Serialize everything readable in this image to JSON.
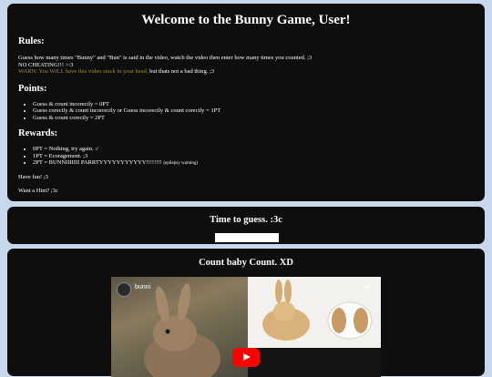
{
  "rules_panel": {
    "title": "Welcome to the Bunny Game, User!",
    "rules_heading": "Rules:",
    "rules_line1": "Guess how many times \"Bunny\" and \"Bun\" is said in the video, watch the video then enter how many times you counted. ;3",
    "rules_line2": "NO CHEATING!!! >:3",
    "warn_text": "WARN: You WILL have this video stuck in your head,",
    "warn_tail": " but thats not a bad thing. ;3",
    "points_heading": "Points:",
    "points": [
      "Guess & count incorectly = 0PT",
      "Guess corectly & count incorrectly or Guess incorectly & count corectly = 1PT",
      "Guess & count corectly = 2PT"
    ],
    "rewards_heading": "Rewards:",
    "reward0": "0PT = Nothing, try again. :/",
    "reward1": "1PT = Ecoragement. ;3",
    "reward2_main": "2PT = BUNNIIIIIII PARRTYYYYYYYYYYY!!!!!!!! ",
    "reward2_note": "(epilepsy warning)",
    "have_fun": "Have fun! ;3",
    "want_hint": "Want a Hint? ;3c"
  },
  "timer_panel": {
    "title": "Time to guess. :3c",
    "guess_value": ""
  },
  "video_panel": {
    "title": "Count baby Count. XD",
    "channel_name": "bunni",
    "share_label": "➦"
  },
  "colors": {
    "page_bg": "#c8d8ec",
    "panel_bg": "#0e0e0e",
    "warn": "#9a8f3a",
    "play_red": "#ff0000"
  }
}
